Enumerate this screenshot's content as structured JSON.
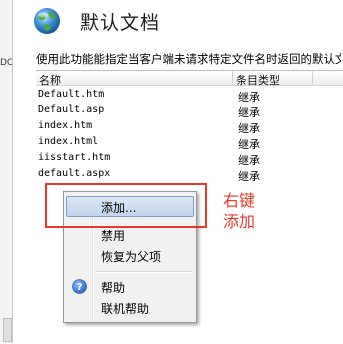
{
  "left_pane": {
    "fragment": "DC"
  },
  "header": {
    "title": "默认文档"
  },
  "description": "使用此功能能指定当客户端未请求特定文件名时返回的默认文",
  "list": {
    "columns": [
      "名称",
      "条目类型"
    ],
    "rows": [
      {
        "name": "Default.htm",
        "type": "继承"
      },
      {
        "name": "Default.asp",
        "type": "继承"
      },
      {
        "name": "index.htm",
        "type": "继承"
      },
      {
        "name": "index.html",
        "type": "继承"
      },
      {
        "name": "iisstart.htm",
        "type": "继承"
      },
      {
        "name": "default.aspx",
        "type": "继承"
      }
    ]
  },
  "context_menu": {
    "items": [
      "添加...",
      "禁用",
      "恢复为父项",
      "帮助",
      "联机帮助"
    ]
  },
  "annotation": {
    "text": "右键添加",
    "color": "#e8382a"
  },
  "icons": {
    "globe": "globe-document-icon",
    "help": "help-icon"
  }
}
